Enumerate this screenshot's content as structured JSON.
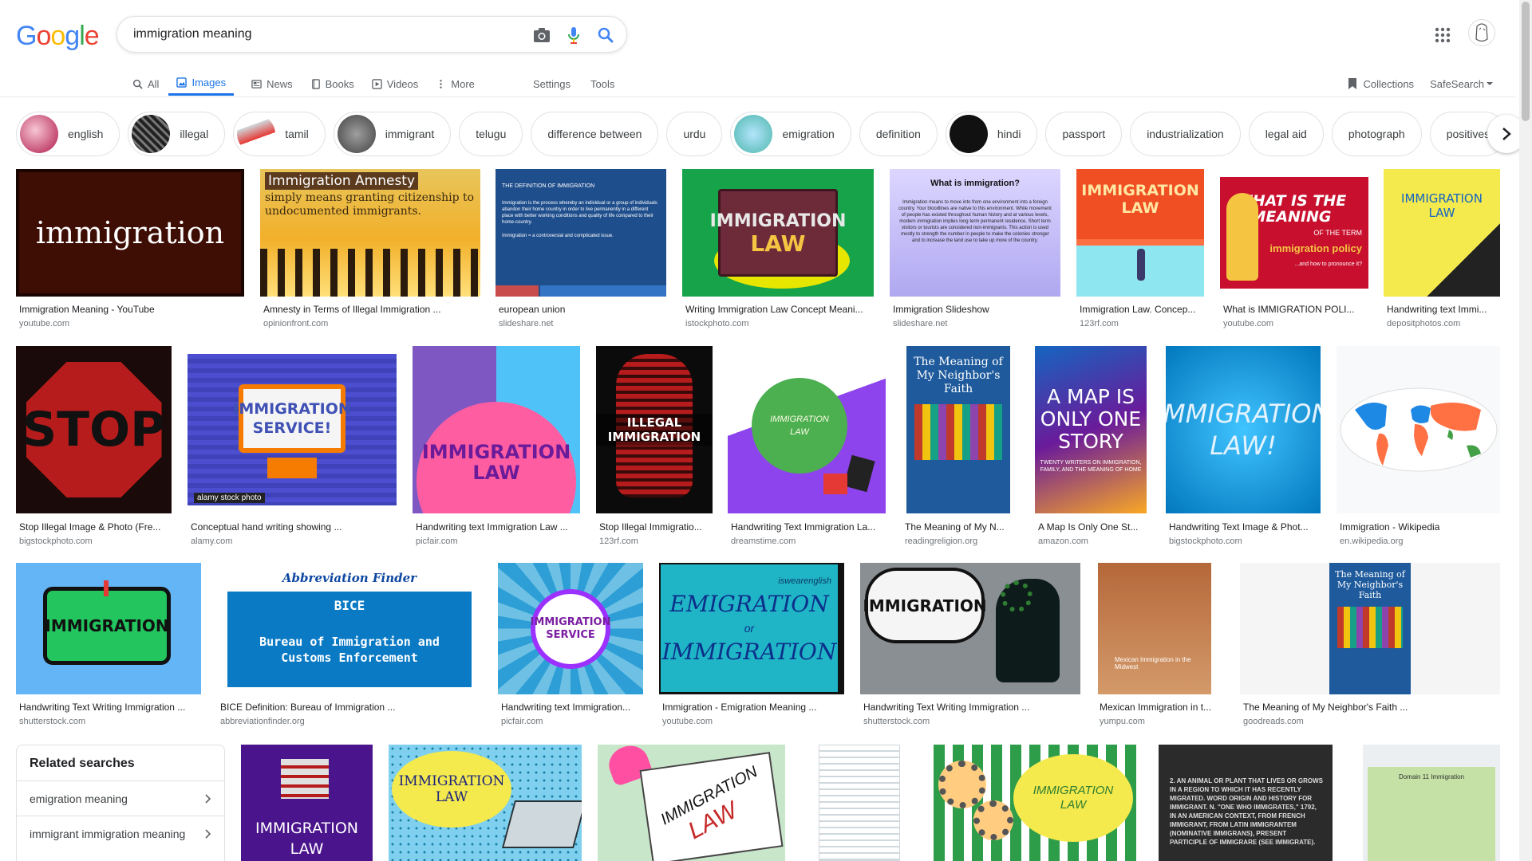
{
  "search": {
    "query": "immigration meaning"
  },
  "tabs": [
    {
      "label": "All"
    },
    {
      "label": "Images"
    },
    {
      "label": "News"
    },
    {
      "label": "Books"
    },
    {
      "label": "Videos"
    },
    {
      "label": "More"
    }
  ],
  "tools": {
    "settings": "Settings",
    "tools": "Tools",
    "collections": "Collections",
    "safesearch": "SafeSearch"
  },
  "chips": [
    {
      "label": "english"
    },
    {
      "label": "illegal"
    },
    {
      "label": "tamil"
    },
    {
      "label": "immigrant"
    },
    {
      "label": "telugu"
    },
    {
      "label": "difference between"
    },
    {
      "label": "urdu"
    },
    {
      "label": "emigration"
    },
    {
      "label": "definition"
    },
    {
      "label": "hindi"
    },
    {
      "label": "passport"
    },
    {
      "label": "industrialization"
    },
    {
      "label": "legal aid"
    },
    {
      "label": "photograph"
    },
    {
      "label": "positives"
    }
  ],
  "results": [
    {
      "caption": "Immigration Meaning - YouTube",
      "source": "youtube.com",
      "text": "immigration"
    },
    {
      "caption": "Amnesty in Terms of Illegal Immigration ...",
      "source": "opinionfront.com",
      "text": "Immigration Amnesty",
      "sub": "simply means granting citizenship to undocumented immigrants."
    },
    {
      "caption": "european union",
      "source": "slideshare.net",
      "text": "THE DEFINITION OF IMMIGRATION",
      "sub": "Immigration is the process whereby an individual or a group of individuals abandon their home country in order to live permanently in a different place with better working conditions and quality of life compared to their home-country.",
      "sub2": "Immigration = a controversial and complicated issue."
    },
    {
      "caption": "Writing Immigration Law Concept Meani...",
      "source": "istockphoto.com",
      "text": "IMMIGRATION",
      "sub": "LAW"
    },
    {
      "caption": "Immigration Slideshow",
      "source": "slideshare.net",
      "text": "What is immigration?",
      "sub": "Immigration means to move into from one environment into a foreign country. Your bloodlines are native to this environment. While movement of people has existed throughout human history and at various levels, modern immigration implies long term permanent residence. Short term visitors or tourists are considered non-immigrants. This action is used mostly to strength the number in people to make the colonies stronger and to increase the land use to take up more of the country."
    },
    {
      "caption": "Immigration Law. Concep...",
      "source": "123rf.com",
      "text": "IMMIGRATION",
      "sub": "LAW"
    },
    {
      "caption": "What is IMMIGRATION POLI...",
      "source": "youtube.com",
      "text": "WHAT IS THE MEANING",
      "sub": "OF THE TERM",
      "sub2": "immigration policy",
      "sub3": "...and how to pronounce it?"
    },
    {
      "caption": "Handwriting text Immi...",
      "source": "depositphotos.com",
      "text": "IMMIGRATION",
      "sub": "LAW"
    },
    {
      "caption": "Stop Illegal Image & Photo (Fre...",
      "source": "bigstockphoto.com",
      "text": "STOP"
    },
    {
      "caption": "Conceptual hand writing showing ...",
      "source": "alamy.com",
      "text": "IMMIGRATION",
      "sub": "SERVICE!",
      "sub2": "alamy stock photo"
    },
    {
      "caption": "Handwriting text Immigration Law ...",
      "source": "picfair.com",
      "text": "IMMIGRATION",
      "sub": "LAW"
    },
    {
      "caption": "Stop Illegal Immigratio...",
      "source": "123rf.com",
      "text": "ILLEGAL IMMIGRATION"
    },
    {
      "caption": "Handwriting Text Immigration La...",
      "source": "dreamstime.com",
      "text": "IMMIGRATION",
      "sub": "LAW"
    },
    {
      "caption": "The Meaning of My N...",
      "source": "readingreligion.org",
      "text": "The Meaning of My Neighbor's Faith"
    },
    {
      "caption": "A Map Is Only One St...",
      "source": "amazon.com",
      "text": "A MAP IS ONLY ONE STORY",
      "sub": "TWENTY WRITERS ON IMMIGRATION, FAMILY, AND THE MEANING OF HOME"
    },
    {
      "caption": "Handwriting Text Image & Phot...",
      "source": "bigstockphoto.com",
      "text": "IMMIGRATION",
      "sub": "LAW!"
    },
    {
      "caption": "Immigration - Wikipedia",
      "source": "en.wikipedia.org"
    },
    {
      "caption": "Handwriting Text Writing Immigration ...",
      "source": "shutterstock.com",
      "text": "IMMIGRATION"
    },
    {
      "caption": "BICE Definition: Bureau of Immigration ...",
      "source": "abbreviationfinder.org",
      "text": "Abbreviation Finder",
      "sub": "BICE",
      "sub2": "Bureau of Immigration and Customs Enforcement"
    },
    {
      "caption": "Handwriting text Immigration...",
      "source": "picfair.com",
      "text": "IMMIGRATION",
      "sub": "SERVICE"
    },
    {
      "caption": "Immigration - Emigration Meaning ...",
      "source": "youtube.com",
      "text": "EMIGRATION",
      "sub": "or",
      "sub2": "IMMIGRATION",
      "sub3": "iswearenglish"
    },
    {
      "caption": "Handwriting Text Writing Immigration ...",
      "source": "shutterstock.com",
      "text": "IMMIGRATION"
    },
    {
      "caption": "Mexican Immigration in t...",
      "source": "yumpu.com",
      "text": "Mexican Immigration in the Midwest"
    },
    {
      "caption": "The Meaning of My Neighbor's Faith ...",
      "source": "goodreads.com",
      "text": "The Meaning of My Neighbor's Faith"
    },
    {
      "text": "IMMIGRATION",
      "sub": "LAW"
    },
    {
      "text": "IMMIGRATION",
      "sub": "LAW"
    },
    {
      "text": "IMMIGRATION",
      "sub": "LAW"
    },
    {},
    {
      "text": "IMMIGRATION",
      "sub": "LAW"
    },
    {
      "text": "2. AN ANIMAL OR PLANT THAT LIVES OR GROWS IN A REGION TO WHICH IT HAS RECENTLY MIGRATED. WORD ORIGIN AND HISTORY FOR IMMIGRANT. N. \"ONE WHO IMMIGRATES,\" 1792, IN AN AMERICAN CONTEXT, FROM FRENCH IMMIGRANT, FROM LATIN IMMIGRANTEM (NOMINATIVE IMMIGRANS), PRESENT PARTICIPLE OF IMMIGRARE (SEE IMMIGRATE)."
    },
    {
      "text": "Domain 11 Immigration"
    }
  ],
  "related": {
    "title": "Related searches",
    "items": [
      {
        "label": "emigration meaning"
      },
      {
        "label": "immigrant immigration meaning"
      }
    ]
  },
  "colors": {
    "accent": "#1a73e8"
  }
}
